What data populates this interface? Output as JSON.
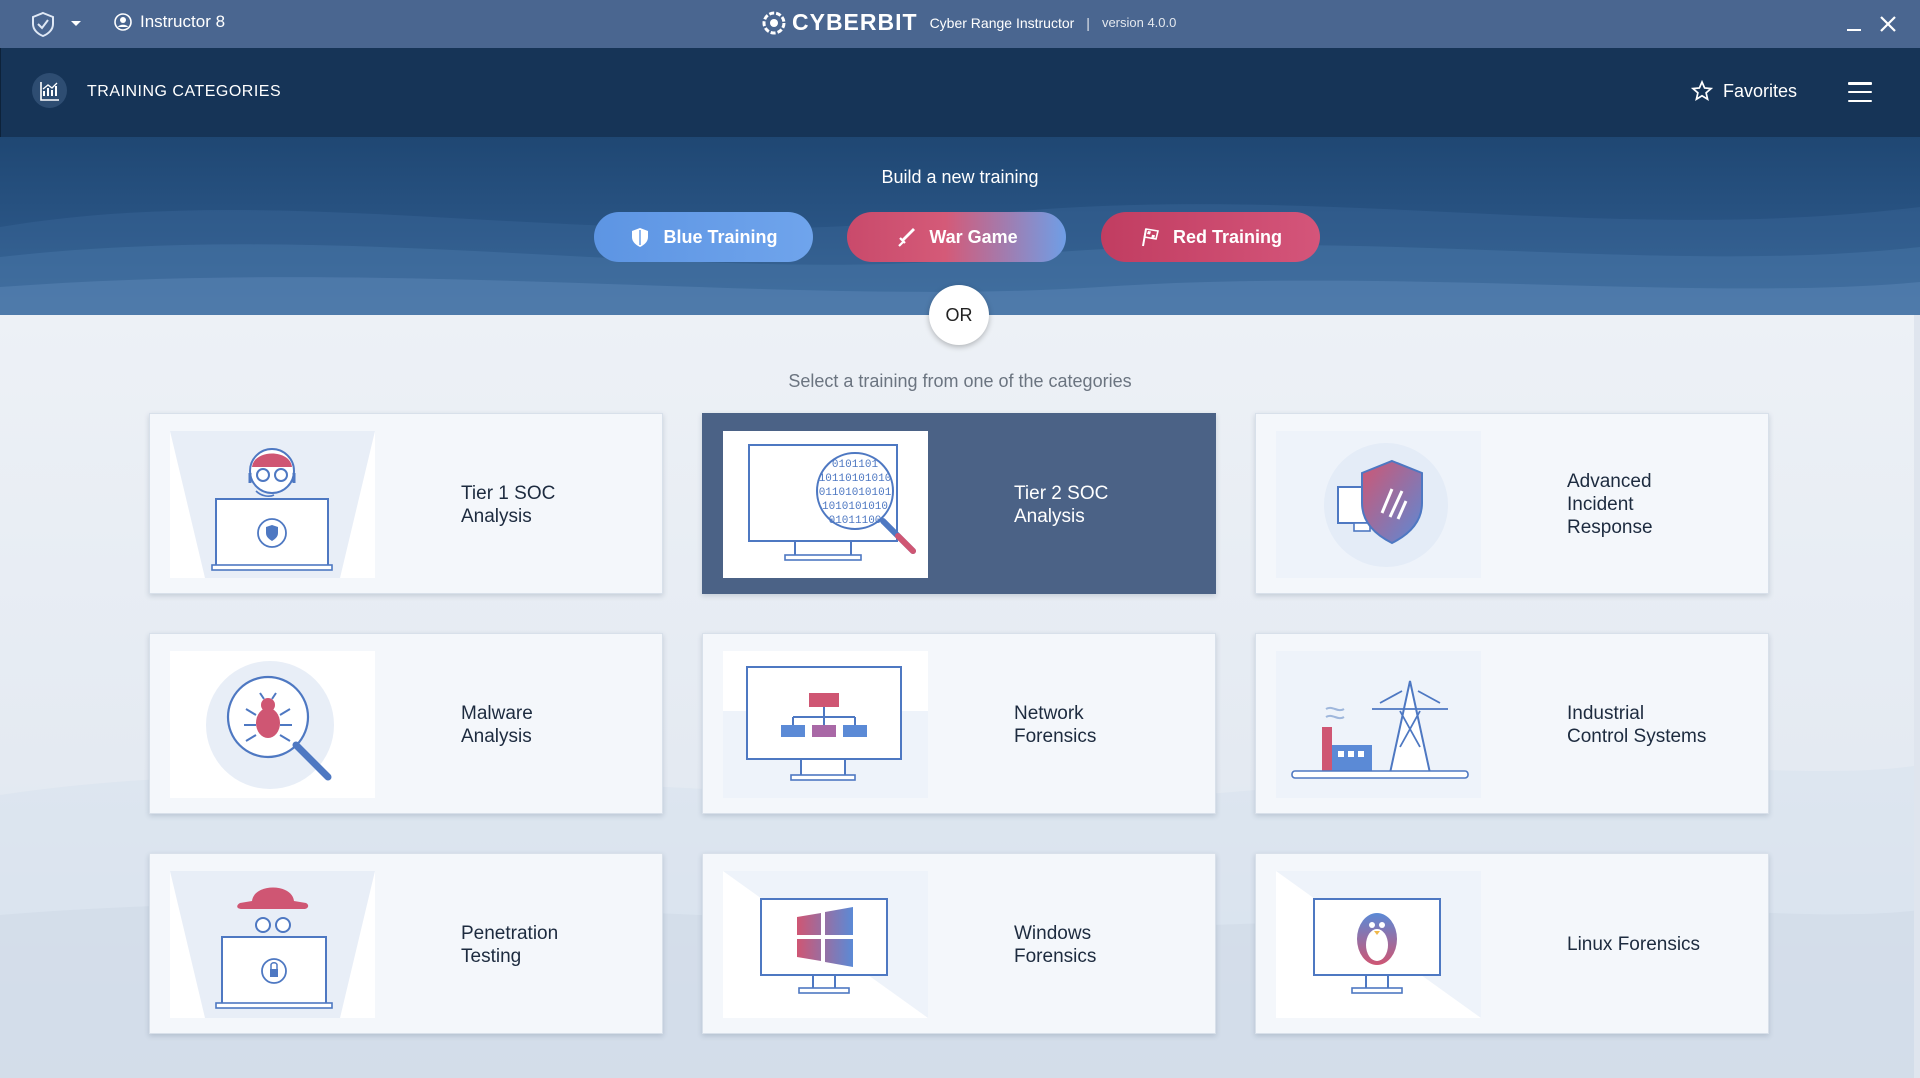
{
  "titlebar": {
    "user": "Instructor 8",
    "logo": "CYBERBIT",
    "app_name": "Cyber Range Instructor",
    "separator": "|",
    "version": "version 4.0.0"
  },
  "header": {
    "title": "TRAINING CATEGORIES",
    "favorites_label": "Favorites"
  },
  "hero": {
    "title": "Build a new training",
    "buttons": [
      {
        "label": "Blue Training",
        "icon": "shield-icon",
        "color": "#6aa1ea"
      },
      {
        "label": "War Game",
        "icon": "sword-icon",
        "color": "#d0516f"
      },
      {
        "label": "Red Training",
        "icon": "flag-icon",
        "color": "#cf4a6f"
      }
    ],
    "or_label": "OR"
  },
  "main": {
    "subtitle": "Select a training from one of the categories",
    "categories": [
      {
        "label_1": "Tier 1 SOC",
        "label_2": "Analysis",
        "icon": "soc-analyst-icon",
        "selected": false
      },
      {
        "label_1": "Tier 2 SOC",
        "label_2": "Analysis",
        "icon": "binary-magnifier-icon",
        "selected": true
      },
      {
        "label_1": "Advanced",
        "label_2": "Incident",
        "label_3": "Response",
        "icon": "shield-monitor-icon",
        "selected": false
      },
      {
        "label_1": "Malware",
        "label_2": "Analysis",
        "icon": "bug-magnifier-icon",
        "selected": false
      },
      {
        "label_1": "Network",
        "label_2": "Forensics",
        "icon": "network-hierarchy-icon",
        "selected": false
      },
      {
        "label_1": "Industrial",
        "label_2": "Control Systems",
        "icon": "power-tower-icon",
        "selected": false
      },
      {
        "label_1": "Penetration",
        "label_2": "Testing",
        "icon": "hacker-hat-icon",
        "selected": false
      },
      {
        "label_1": "Windows",
        "label_2": "Forensics",
        "icon": "windows-logo-icon",
        "selected": false
      },
      {
        "label_1": "Linux Forensics",
        "icon": "linux-penguin-icon",
        "selected": false
      }
    ]
  },
  "colors": {
    "titlebar": "#4a6690",
    "header": "#163457",
    "accent_blue": "#5b8ad6",
    "accent_pink": "#d0516f",
    "selected_card": "#4b6286"
  }
}
